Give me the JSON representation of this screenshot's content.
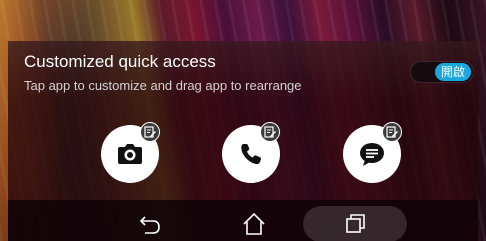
{
  "quick_access": {
    "title": "Customized quick access",
    "subtitle": "Tap app to customize and drag app to rearrange",
    "toggle_label": "開啟",
    "accent": "#1ba7dc"
  },
  "shortcuts": [
    {
      "name": "camera",
      "icon": "camera-icon",
      "badge_icon": "edit-icon"
    },
    {
      "name": "phone",
      "icon": "phone-icon",
      "badge_icon": "edit-icon"
    },
    {
      "name": "messages",
      "icon": "message-icon",
      "badge_icon": "edit-icon"
    }
  ],
  "navbar": {
    "back_icon": "back-icon",
    "home_icon": "home-icon",
    "recents_icon": "recents-icon"
  }
}
